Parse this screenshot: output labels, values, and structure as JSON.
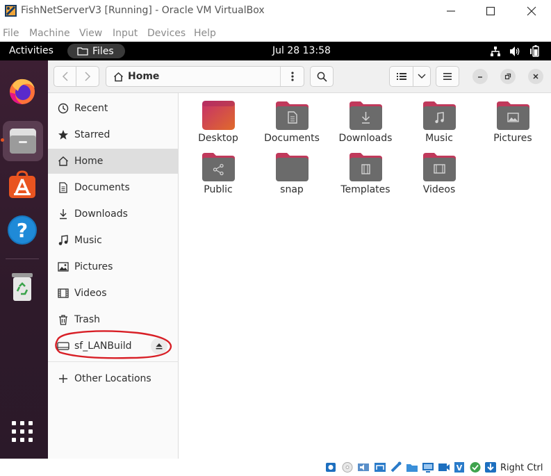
{
  "host_window": {
    "title": "FishNetServerV3 [Running] - Oracle VM VirtualBox",
    "menu": [
      "File",
      "Machine",
      "View",
      "Input",
      "Devices",
      "Help"
    ]
  },
  "gnome_topbar": {
    "activities": "Activities",
    "app_name": "Files",
    "clock": "Jul 28  13:58"
  },
  "dock": {
    "items": [
      "firefox-icon",
      "files-icon",
      "app-center-icon",
      "help-icon",
      "trash-icon"
    ],
    "show_apps": "apps-grid-icon"
  },
  "files": {
    "path": "Home",
    "sidebar": [
      {
        "label": "Recent",
        "icon": "clock-icon"
      },
      {
        "label": "Starred",
        "icon": "star-icon"
      },
      {
        "label": "Home",
        "icon": "home-icon",
        "active": true
      },
      {
        "label": "Documents",
        "icon": "document-icon"
      },
      {
        "label": "Downloads",
        "icon": "download-icon"
      },
      {
        "label": "Music",
        "icon": "music-icon"
      },
      {
        "label": "Pictures",
        "icon": "picture-icon"
      },
      {
        "label": "Videos",
        "icon": "film-icon"
      },
      {
        "label": "Trash",
        "icon": "trash-icon"
      },
      {
        "label": "sf_LANBuild",
        "icon": "drive-icon"
      }
    ],
    "other_locations": "Other Locations",
    "folders": [
      {
        "label": "Desktop",
        "icon": "desktop-folder-icon"
      },
      {
        "label": "Documents",
        "icon": "documents-folder-icon"
      },
      {
        "label": "Downloads",
        "icon": "downloads-folder-icon"
      },
      {
        "label": "Music",
        "icon": "music-folder-icon"
      },
      {
        "label": "Pictures",
        "icon": "pictures-folder-icon"
      },
      {
        "label": "Public",
        "icon": "public-folder-icon"
      },
      {
        "label": "snap",
        "icon": "folder-icon"
      },
      {
        "label": "Templates",
        "icon": "templates-folder-icon"
      },
      {
        "label": "Videos",
        "icon": "videos-folder-icon"
      }
    ]
  },
  "statusbar": {
    "host_key": "Right Ctrl"
  },
  "colors": {
    "folder_tab": "#c0395b",
    "folder_body": "#6b6b6b",
    "annotation": "#d81f26",
    "dock_bg": "#2e1a2a",
    "ubuntu_orange": "#e95420"
  }
}
